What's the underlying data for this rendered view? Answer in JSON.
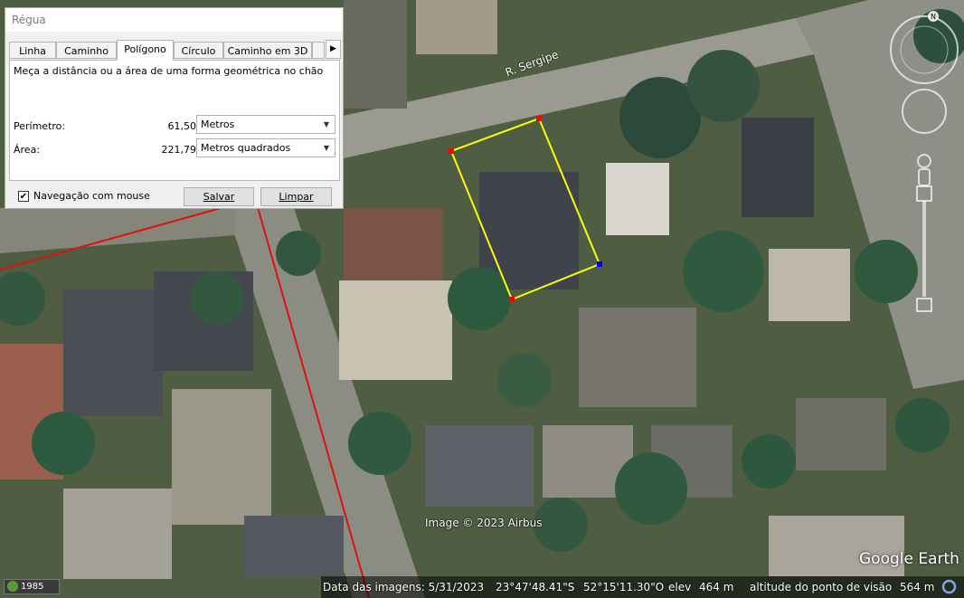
{
  "dialog": {
    "title": "Régua",
    "tabs": [
      {
        "label": "Linha"
      },
      {
        "label": "Caminho"
      },
      {
        "label": "Polígono"
      },
      {
        "label": "Círculo"
      },
      {
        "label": "Caminho em 3D"
      }
    ],
    "active_tab": "Polígono",
    "description": "Meça a distância ou a área de uma forma geométrica no chão",
    "perimeter_label": "Perímetro:",
    "perimeter_value": "61,50",
    "perimeter_unit": "Metros",
    "area_label": "Área:",
    "area_value": "221,79",
    "area_unit": "Metros quadrados",
    "mouse_nav_label": "Navegação com mouse",
    "mouse_nav_checked": true,
    "save_label": "Salvar",
    "clear_label": "Limpar"
  },
  "map": {
    "street_label": "R. Sergipe",
    "copyright": "Image © 2023 Airbus",
    "logo": "Google Earth",
    "polygon_color": "#ffff00",
    "boundary_color": "#e01010"
  },
  "status_bar": {
    "history_year": "1985",
    "image_date": "Data das imagens: 5/31/2023",
    "latitude": "23°47'48.41\"S",
    "longitude": "52°15'11.30\"O",
    "elev_label": "elev",
    "elev_value": "464 m",
    "eye_alt_label": "altitude do ponto de visão",
    "eye_alt_value": "564 m"
  }
}
